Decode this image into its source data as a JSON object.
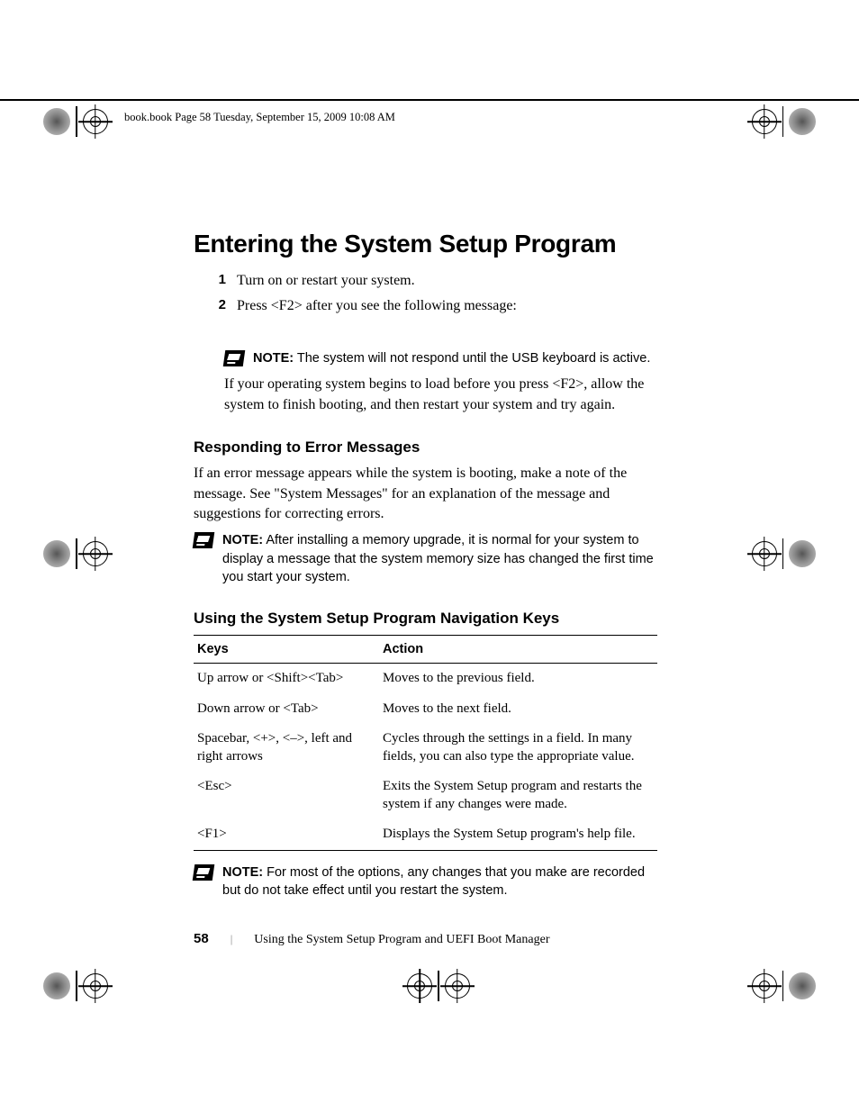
{
  "header": "book.book  Page 58  Tuesday, September 15, 2009  10:08 AM",
  "title": "Entering the System Setup Program",
  "steps": [
    {
      "num": "1",
      "text": "Turn on or restart your system."
    },
    {
      "num": "2",
      "text": "Press <F2> after you see the following message:"
    }
  ],
  "note1_label": "NOTE:",
  "note1": " The system will not respond until the USB keyboard is active.",
  "followup": "If your operating system begins to load before you press <F2>, allow the system to finish booting, and then restart your system and try again.",
  "h2a": "Responding to Error Messages",
  "body_a": "If an error message appears while the system is booting, make a note of the message. See \"System Messages\" for an explanation of the message and suggestions for correcting errors.",
  "note2_label": "NOTE:",
  "note2": " After installing a memory upgrade, it is normal for your system to display a message that the system memory size has changed the first time you start your system.",
  "h2b": "Using the System Setup Program Navigation Keys",
  "table": {
    "head": {
      "keys": "Keys",
      "action": "Action"
    },
    "rows": [
      {
        "keys": "Up arrow or <Shift><Tab>",
        "action": "Moves to the previous field."
      },
      {
        "keys": "Down arrow or <Tab>",
        "action": "Moves to the next field."
      },
      {
        "keys": "Spacebar, <+>, <–>, left and right arrows",
        "action": "Cycles through the settings in a field. In many fields, you can also type the appropriate value."
      },
      {
        "keys": "<Esc>",
        "action": "Exits the System Setup program and restarts the system if any changes were made."
      },
      {
        "keys": "<F1>",
        "action": "Displays the System Setup program's help file."
      }
    ]
  },
  "note3_label": "NOTE:",
  "note3": " For most of the options, any changes that you make are recorded but do not take effect until you restart the system.",
  "footer": {
    "page": "58",
    "title": "Using the System Setup Program and UEFI Boot Manager"
  }
}
